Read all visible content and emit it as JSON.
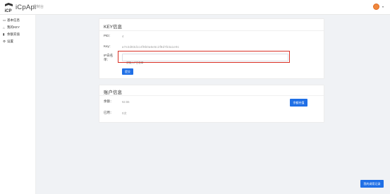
{
  "header": {
    "brand": "iCpApi",
    "nav_link": "控制台"
  },
  "sidebar": {
    "items": [
      {
        "icon": "card-icon",
        "glyph": "▭",
        "label": "基本信息"
      },
      {
        "icon": "key-icon",
        "glyph": "⌂",
        "label": "我的KEY"
      },
      {
        "icon": "recharge-icon",
        "glyph": "▮",
        "label": "余额充值"
      },
      {
        "icon": "gear-icon",
        "glyph": "⚙",
        "label": "设置"
      }
    ]
  },
  "key_card": {
    "title": "KEY信息",
    "pid_label": "PID：",
    "pid_value": "4",
    "key_label": "Key：",
    "key_value": "a7e2d83d1c4f9b0a6e5c2f8d7b3a1e9c",
    "project_label": "IP白名单：",
    "project_placeholder": "请输入IP白名单",
    "submit_label": "提交"
  },
  "account_card": {
    "title": "账户信息",
    "balance_label": "余额：",
    "balance_value": "¥2.55",
    "recharge_label": "余额充值",
    "used_label": "已用：",
    "used_value": "0次"
  },
  "float_button": {
    "label": "我的调用记录"
  }
}
